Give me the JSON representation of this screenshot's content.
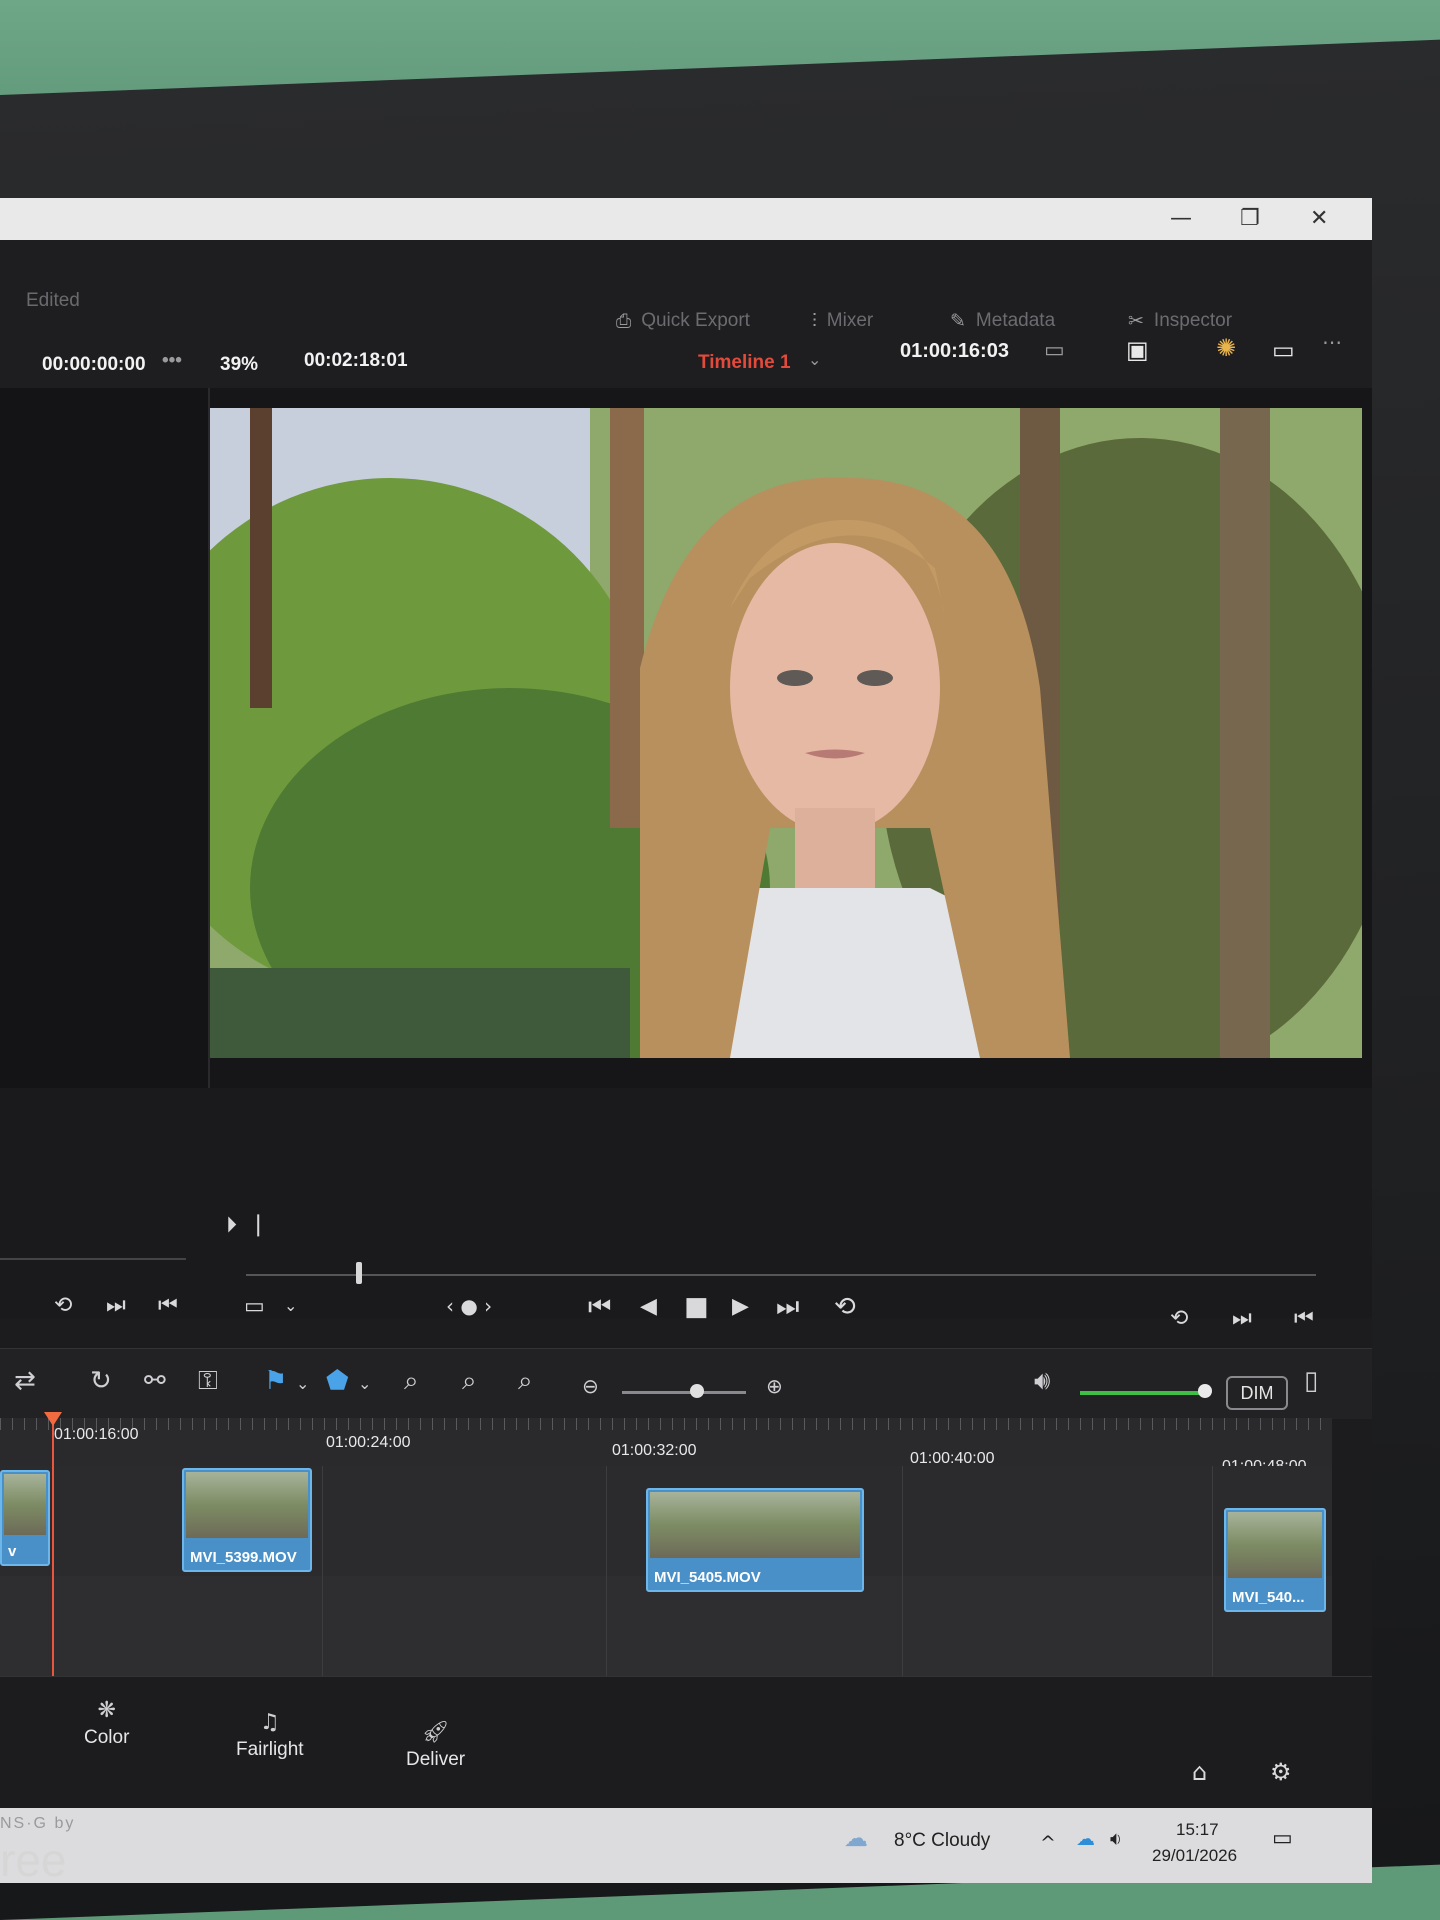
{
  "window": {
    "minimize": "—",
    "restore": "❐",
    "close": "✕"
  },
  "header": {
    "edited_label": "Edited",
    "source_tc": "00:00:00:00",
    "more": "•••",
    "zoom": "39%",
    "duration": "00:02:18:01",
    "tabs": [
      {
        "label": "Quick Export",
        "icon": "export-icon"
      },
      {
        "label": "Mixer",
        "icon": "mixer-icon"
      },
      {
        "label": "Metadata",
        "icon": "metadata-icon"
      },
      {
        "label": "Inspector",
        "icon": "inspector-icon"
      }
    ],
    "timeline_name": "Timeline 1",
    "record_tc": "01:00:16:03"
  },
  "transport": {
    "skip_start": "⏮",
    "prev_frame": "◀",
    "stop": "■",
    "play": "▶",
    "skip_end": "⏭",
    "loop": "⟲",
    "jog": "‹ ● ›"
  },
  "timeline": {
    "ruler_labels": [
      "01:00:16:00",
      "01:00:24:00",
      "01:00:32:00",
      "01:00:40:00",
      "01:00:48:00"
    ],
    "clips": [
      {
        "label": "v"
      },
      {
        "label": "MVI_5399.MOV"
      },
      {
        "label": "MVI_5405.MOV"
      },
      {
        "label": "MVI_540..."
      }
    ],
    "dim_label": "DIM"
  },
  "pages": [
    {
      "label": "Color",
      "icon": "color-page-icon"
    },
    {
      "label": "Fairlight",
      "icon": "fairlight-page-icon"
    },
    {
      "label": "Deliver",
      "icon": "deliver-page-icon"
    }
  ],
  "taskbar": {
    "weather": "8°C  Cloudy",
    "time": "15:17",
    "date": "29/01/2026"
  },
  "monitor": {
    "brand_top": "NS·G by",
    "brand": "ree"
  }
}
